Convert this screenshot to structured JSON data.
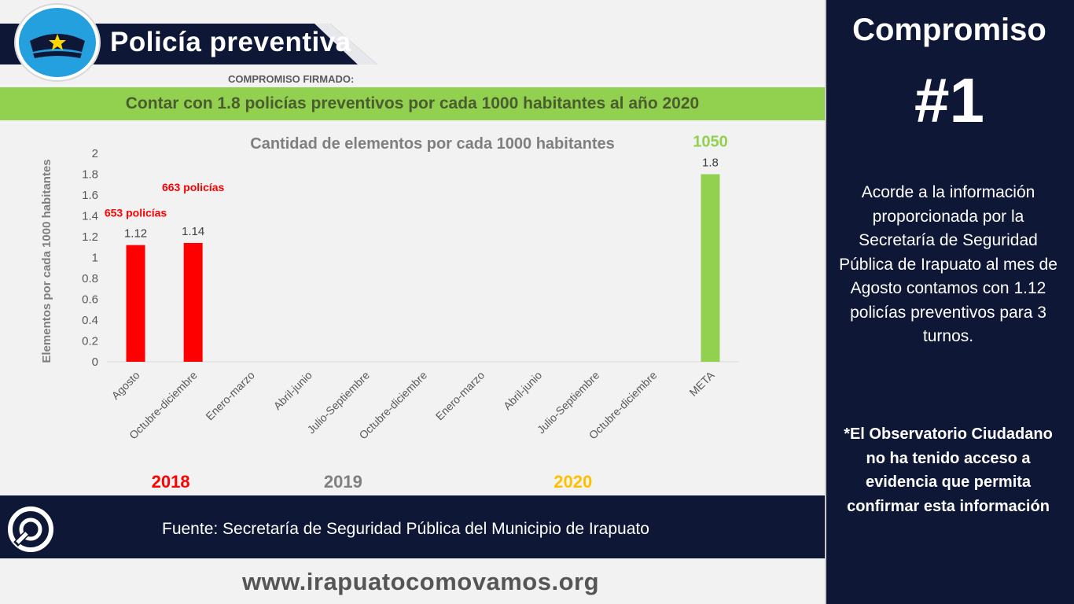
{
  "header": {
    "title": "Policía preventiva",
    "signed_label": "COMPROMISO FIRMADO:"
  },
  "commitment": {
    "text": "Contar con 1.8 policías preventivos por cada 1000 habitantes al año 2020"
  },
  "chart_data": {
    "type": "bar",
    "title": "Cantidad de elementos por cada 1000 habitantes",
    "ylabel": "Elementos por cada  1000 habitantes",
    "xlabel": "",
    "ylim": [
      0,
      2
    ],
    "yticks": [
      "0",
      "0.2",
      "0.4",
      "0.6",
      "0.8",
      "1",
      "1.2",
      "1.4",
      "1.6",
      "1.8",
      "2"
    ],
    "categories": [
      "Agosto",
      "Octubre-diciembre",
      "Enero-marzo",
      "Abril-junio",
      "Julio-Septiembre",
      "Octubre-diciembre",
      "Enero-marzo",
      "Abril-junio",
      "Julio-Septiembre",
      "Octubre-diciembre",
      "META"
    ],
    "values": [
      1.12,
      1.14,
      null,
      null,
      null,
      null,
      null,
      null,
      null,
      null,
      1.8
    ],
    "value_labels": [
      "1.12",
      "1.14",
      "",
      "",
      "",
      "",
      "",
      "",
      "",
      "",
      "1.8"
    ],
    "bar_colors": [
      "#ff0000",
      "#ff0000",
      "#ff0000",
      "#ff0000",
      "#ff0000",
      "#ff0000",
      "#ff0000",
      "#ff0000",
      "#ff0000",
      "#ff0000",
      "#92d050"
    ],
    "annotations": [
      {
        "category_index": 0,
        "text": "653 policías",
        "color": "#ff0000"
      },
      {
        "category_index": 1,
        "text": "663 policías",
        "color": "#ff0000"
      },
      {
        "category_index": 10,
        "text": "1050",
        "color": "#92d050"
      }
    ],
    "year_groups": [
      {
        "label": "2018",
        "color": "#ff0000",
        "first": 0,
        "last": 1
      },
      {
        "label": "2019",
        "color": "#7f7f7f",
        "first": 2,
        "last": 5
      },
      {
        "label": "2020",
        "color": "#ffc000",
        "first": 6,
        "last": 9
      }
    ],
    "grid": false,
    "legend": "none"
  },
  "footer": {
    "source": "Fuente:  Secretaría de Seguridad Pública del Municipio de Irapuato",
    "website": "www.irapuatocomovamos.org"
  },
  "side_panel": {
    "title": "Compromiso",
    "number": "#1",
    "info": "Acorde a la información proporcionada por la Secretaría de Seguridad Pública de Irapuato al mes de Agosto contamos con 1.12 policías preventivos para 3 turnos.",
    "note": "*El Observatorio Ciudadano no ha tenido acceso a evidencia que permita confirmar esta información"
  },
  "colors": {
    "navy": "#0f1736",
    "green": "#92d050",
    "logo_blue": "#25a0df",
    "star": "#ffd700"
  }
}
